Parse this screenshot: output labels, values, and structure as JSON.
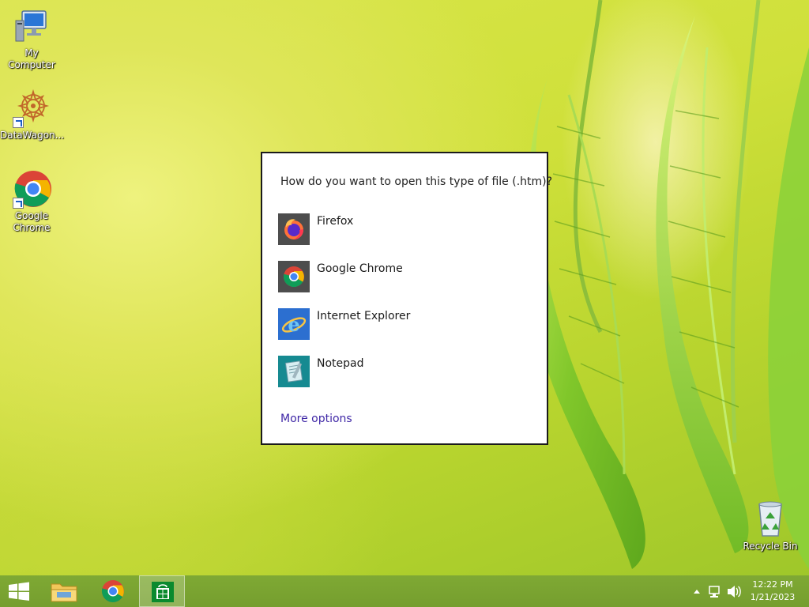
{
  "desktop": {
    "icons": [
      {
        "label": "My Computer",
        "icon": "computer-icon"
      },
      {
        "label": "DataWagon...",
        "icon": "datawagon-icon"
      },
      {
        "label": "Google Chrome",
        "icon": "chrome-icon"
      },
      {
        "label": "Recycle Bin",
        "icon": "recycle-bin-icon"
      }
    ]
  },
  "dialog": {
    "title": "How do you want to open this type of file (.htm)?",
    "apps": [
      {
        "label": "Firefox",
        "icon": "firefox-icon",
        "tile_color": "#4d4d4d"
      },
      {
        "label": "Google Chrome",
        "icon": "chrome-icon",
        "tile_color": "#4d4d4d"
      },
      {
        "label": "Internet Explorer",
        "icon": "internet-explorer-icon",
        "tile_color": "#2c6fd0"
      },
      {
        "label": "Notepad",
        "icon": "notepad-icon",
        "tile_color": "#168a91"
      }
    ],
    "more_options": "More options",
    "link_color": "#3f27a6"
  },
  "taskbar": {
    "buttons": [
      {
        "name": "start",
        "icon": "windows-logo-icon"
      },
      {
        "name": "file-explorer",
        "icon": "folder-icon"
      },
      {
        "name": "chrome",
        "icon": "chrome-icon"
      },
      {
        "name": "store",
        "icon": "store-icon",
        "active": true
      }
    ],
    "tray": {
      "icons": [
        "show-hidden-icons-icon",
        "network-icon",
        "volume-icon"
      ]
    },
    "clock": {
      "time": "12:22 PM",
      "date": "1/21/2023"
    }
  }
}
